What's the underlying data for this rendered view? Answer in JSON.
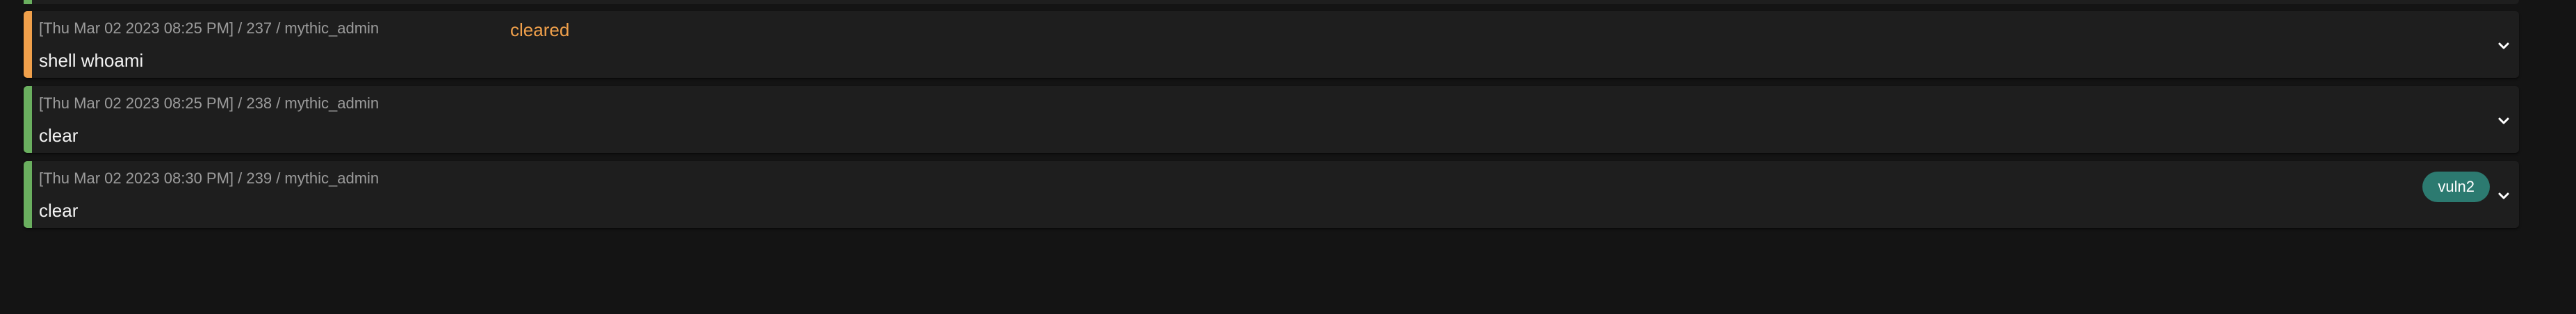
{
  "colors": {
    "background": "#141414",
    "card": "#1e1e1e",
    "status_error": "#f0a04b",
    "status_success": "#6aaf5f",
    "comment_text": "#f0a04b",
    "tag_background": "#2c7a70"
  },
  "tasks": [
    {
      "meta": "[Thu Mar 02 2023 08:25 PM] / 237 / mythic_admin",
      "command": "shell whoami",
      "comment": "cleared",
      "tag": "",
      "status_color": "#f0a04b",
      "expand_icon": "chevron-down-icon"
    },
    {
      "meta": "[Thu Mar 02 2023 08:25 PM] / 238 / mythic_admin",
      "command": "clear",
      "comment": "",
      "tag": "",
      "status_color": "#6aaf5f",
      "expand_icon": "chevron-down-icon"
    },
    {
      "meta": "[Thu Mar 02 2023 08:30 PM] / 239 / mythic_admin",
      "command": "clear",
      "comment": "",
      "tag": "vuln2",
      "status_color": "#6aaf5f",
      "expand_icon": "chevron-down-icon"
    }
  ]
}
